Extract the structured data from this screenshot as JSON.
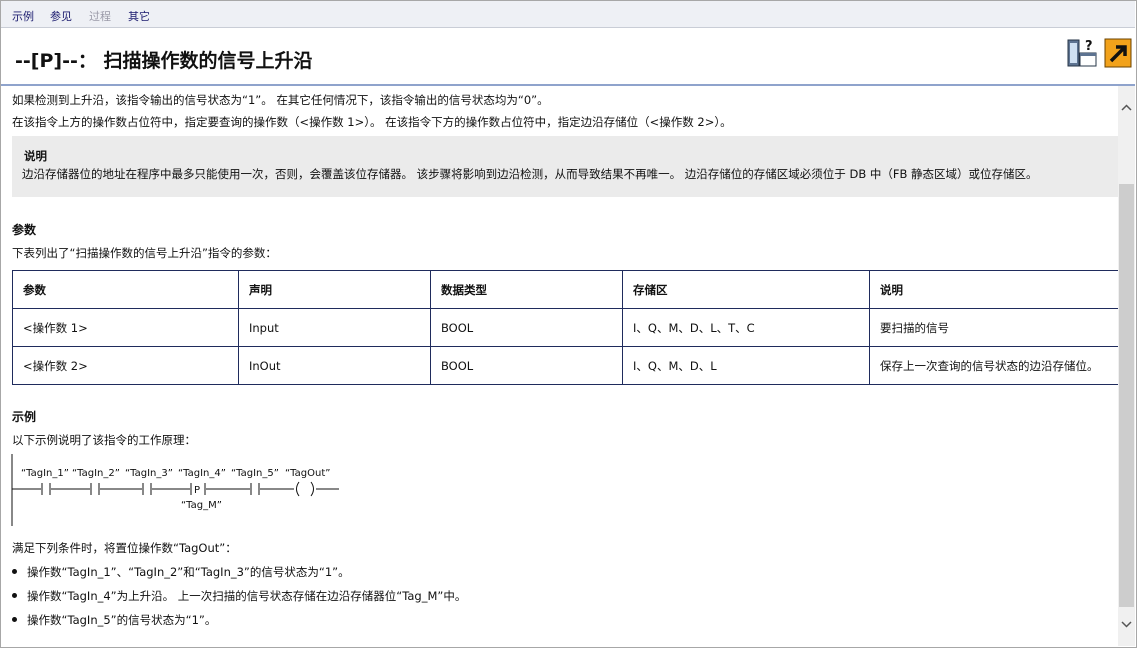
{
  "nav": {
    "items": [
      {
        "label": "示例",
        "disabled": false
      },
      {
        "label": "参见",
        "disabled": false
      },
      {
        "label": "过程",
        "disabled": true
      },
      {
        "label": "其它",
        "disabled": false
      }
    ]
  },
  "header": {
    "title": "--[P]--： 扫描操作数的信号上升沿",
    "icons": [
      "help-window-icon",
      "jump-link-icon"
    ]
  },
  "intro": {
    "line1": "如果检测到上升沿，该指令输出的信号状态为“1”。 在其它任何情况下，该指令输出的信号状态均为“0”。",
    "line2": "在该指令上方的操作数占位符中，指定要查询的操作数（<操作数 1>）。 在该指令下方的操作数占位符中，指定边沿存储位（<操作数 2>）。"
  },
  "note": {
    "title": "说明",
    "body": "边沿存储器位的地址在程序中最多只能使用一次，否则，会覆盖该位存储器。 该步骤将影响到边沿检测，从而导致结果不再唯一。 边沿存储位的存储区域必须位于 DB 中（FB 静态区域）或位存储区。"
  },
  "params": {
    "heading": "参数",
    "desc": "下表列出了“扫描操作数的信号上升沿”指令的参数：",
    "columns": [
      "参数",
      "声明",
      "数据类型",
      "存储区",
      "说明"
    ],
    "rows": [
      [
        "<操作数 1>",
        "Input",
        "BOOL",
        "I、Q、M、D、L、T、C",
        "要扫描的信号"
      ],
      [
        "<操作数 2>",
        "InOut",
        "BOOL",
        "I、Q、M、D、L",
        "保存上一次查询的信号状态的边沿存储位。"
      ]
    ]
  },
  "example": {
    "heading": "示例",
    "desc": "以下示例说明了该指令的工作原理：",
    "ladder": {
      "contacts": [
        "“TagIn_1”",
        "“TagIn_2”",
        "“TagIn_3”",
        "“TagIn_4”",
        "“TagIn_5”"
      ],
      "coil": "“TagOut”",
      "edge_label": "P",
      "edge_memory": "“Tag_M”"
    },
    "conditions_intro": "满足下列条件时，将置位操作数“TagOut”：",
    "bullets": [
      "操作数“TagIn_1”、“TagIn_2”和“TagIn_3”的信号状态为“1”。",
      "操作数“TagIn_4”为上升沿。 上一次扫描的信号状态存储在边沿存储器位“Tag_M”中。",
      "操作数“TagIn_5”的信号状态为“1”。"
    ]
  },
  "colors": {
    "nav_bg": "#eef0f5",
    "header_rule": "#8fa3cc",
    "table_border": "#1f2b5c",
    "note_bg": "#ebebeb",
    "jump_icon": "#f2a21b"
  }
}
